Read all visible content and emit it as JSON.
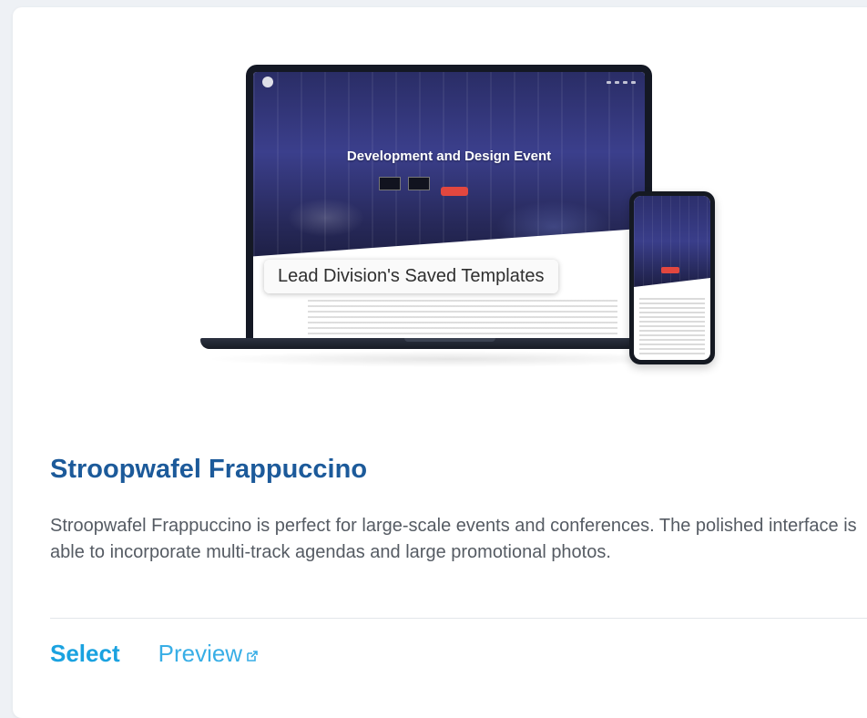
{
  "template": {
    "mockup": {
      "site_heading": "Development and Design Event",
      "caption": "Lead Division's Saved Templates"
    },
    "title": "Stroopwafel Frappuccino",
    "description": "Stroopwafel Frappuccino is perfect for large-scale events and conferences. The polished interface is able to incorporate multi-track agendas and large promotional photos.",
    "actions": {
      "select_label": "Select",
      "preview_label": "Preview",
      "preview_icon": "external-link-icon"
    }
  },
  "colors": {
    "title": "#1c5a9a",
    "action": "#1aa2e0",
    "accent_red": "#e2473f"
  }
}
